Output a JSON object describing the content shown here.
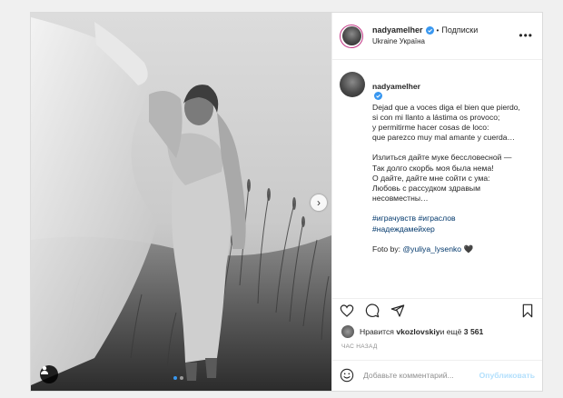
{
  "post": {
    "username": "nadyamelher",
    "follow_label": "Подписки",
    "location": "Ukraine Україна",
    "more_glyph": "•••",
    "caption": {
      "username": "nadyamelher",
      "text": "Dejad que a voces diga el bien que pierdo,\nsi con mi llanto a lástima os provoco;\ny permitirme hacer cosas de loco:\nque parezco muy mal amante y cuerda…",
      "text_ru": "Излиться дайте муке бессловесной —\nТак долго скорбь моя была нема!\nО дайте, дайте мне сойти с ума:\nЛюбовь с рассудком здравым несовместны…",
      "hashtags": "#играчувств #играслов\n#надеждамейхер",
      "credit_prefix": "Foto by: ",
      "credit_mention": "@yuliya_lysenko",
      "credit_emoji": "🖤"
    },
    "likes": {
      "prefix": "Нравится ",
      "user": "vkozlovskiy",
      "middle": " и ещё ",
      "count": "3 561"
    },
    "timestamp": "ЧАС НАЗАД",
    "comment_input": {
      "placeholder": "Добавьте комментарий...",
      "value": ""
    },
    "post_button": "Опубликовать",
    "carousel": {
      "slides": 2,
      "active": 1
    }
  },
  "icons": {
    "header": [
      "verified-badge-icon",
      "more-options-icon"
    ],
    "photo": [
      "next-arrow-icon",
      "user-tag-icon"
    ],
    "actions": [
      "heart-icon",
      "comment-icon",
      "share-icon",
      "bookmark-icon"
    ],
    "composer": [
      "emoji-icon"
    ]
  },
  "colors": {
    "link": "#00376b",
    "verified": "#3897f0",
    "post_button_disabled": "#b2dffc",
    "muted": "#8e8e8e"
  }
}
